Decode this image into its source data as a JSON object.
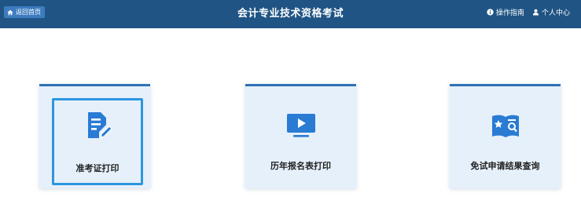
{
  "header": {
    "home_label": "返回首页",
    "title": "会计专业技术资格考试",
    "guide_label": "操作指南",
    "user_center_label": "个人中心"
  },
  "cards": [
    {
      "label": "准考证打印",
      "icon": "document-edit-icon"
    },
    {
      "label": "历年报名表打印",
      "icon": "monitor-play-icon"
    },
    {
      "label": "免试申请结果查询",
      "icon": "book-search-icon"
    }
  ],
  "colors": {
    "header_bg": "#1f5485",
    "accent": "#2f72b6",
    "card_bg": "#e6f0fb",
    "selected_border": "#2b96e0",
    "icon_blue": "#2a7bd4"
  }
}
